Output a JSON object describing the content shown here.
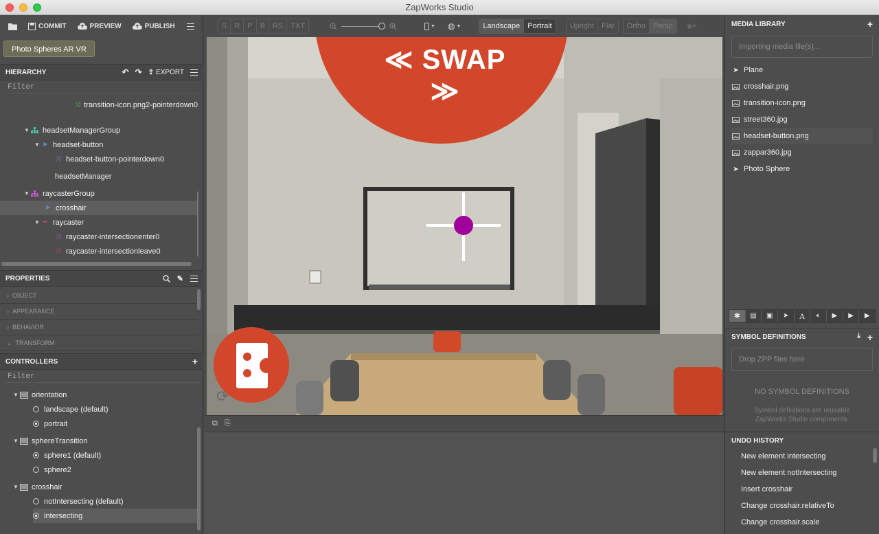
{
  "window": {
    "title": "ZapWorks Studio"
  },
  "toolbar": {
    "commit": "COMMIT",
    "preview": "PREVIEW",
    "publish": "PUBLISH",
    "project_button": "Photo Spheres AR VR"
  },
  "hierarchy": {
    "title": "HIERARCHY",
    "export_label": "EXPORT",
    "filter_placeholder": "Filter",
    "items": [
      {
        "label": "transition-icon.png2-pointerdown0",
        "icon": "transition-icon",
        "icon_color": "#4cc46a"
      },
      {
        "label": "headsetManagerGroup",
        "icon": "group-icon",
        "icon_color": "#46c8a3"
      },
      {
        "label": "headset-button",
        "icon": "plane-icon",
        "icon_color": "#6a8fd8"
      },
      {
        "label": "headset-button-pointerdown0",
        "icon": "transition-icon",
        "icon_color": "#6a8fd8"
      },
      {
        "label": "headsetManager",
        "icon": "",
        "icon_color": ""
      },
      {
        "label": "raycasterGroup",
        "icon": "group-icon",
        "icon_color": "#c85ad0"
      },
      {
        "label": "crosshair",
        "icon": "plane-icon",
        "icon_color": "#6a8fd8"
      },
      {
        "label": "raycaster",
        "icon": "raycaster-icon",
        "icon_color": "#e0406a"
      },
      {
        "label": "raycaster-intersectionenter0",
        "icon": "transition-icon",
        "icon_color": "#c85ad0"
      },
      {
        "label": "raycaster-intersectionleave0",
        "icon": "transition-icon",
        "icon_color": "#e0406a"
      }
    ]
  },
  "properties": {
    "title": "PROPERTIES",
    "sections": [
      "OBJECT",
      "APPEARANCE",
      "BEHAVIOR",
      "TRANSFORM"
    ]
  },
  "controllers": {
    "title": "CONTROLLERS",
    "filter_placeholder": "Filter",
    "groups": [
      {
        "name": "orientation",
        "states": [
          {
            "label": "landscape (default)",
            "checked": false
          },
          {
            "label": "portrait",
            "checked": true
          }
        ]
      },
      {
        "name": "sphereTransition",
        "states": [
          {
            "label": "sphere1 (default)",
            "checked": true
          },
          {
            "label": "sphere2",
            "checked": false
          }
        ]
      },
      {
        "name": "crosshair",
        "states": [
          {
            "label": "notIntersecting (default)",
            "checked": false
          },
          {
            "label": "intersecting",
            "checked": true
          }
        ]
      }
    ]
  },
  "viewport_toolbar": {
    "text_modes": [
      "S",
      "R",
      "P",
      "B",
      "RS",
      "TXT"
    ],
    "orientation_options": [
      "Landscape",
      "Portrait"
    ],
    "orientation_selected": "Landscape",
    "view_options": [
      "Upright",
      "Flat"
    ],
    "projection_options": [
      "Ortho",
      "Persp"
    ]
  },
  "viewport": {
    "swap_label": "≪ SWAP ≫",
    "accent_color": "#d2472b",
    "crosshair_dot_color": "#a1009a"
  },
  "media_library": {
    "title": "MEDIA LIBRARY",
    "status_text": "Importing media file(s)...",
    "items": [
      {
        "label": "Plane",
        "icon": "plane-icon"
      },
      {
        "label": "crosshair.png",
        "icon": "image-icon"
      },
      {
        "label": "transition-icon.png",
        "icon": "image-icon"
      },
      {
        "label": "street360.jpg",
        "icon": "image-icon"
      },
      {
        "label": "headset-button.png",
        "icon": "image-icon"
      },
      {
        "label": "zappar360.jpg",
        "icon": "image-icon"
      },
      {
        "label": "Photo Sphere",
        "icon": "plane-icon"
      }
    ]
  },
  "symbol_definitions": {
    "title": "SYMBOL DEFINITIONS",
    "drop_placeholder": "Drop ZPP files here",
    "empty_title": "NO SYMBOL DEFINITIONS",
    "empty_desc": "Symbol definitions are reusable ZapWorks Studio components."
  },
  "undo_history": {
    "title": "UNDO HISTORY",
    "items": [
      "New element intersecting",
      "New element notIntersecting",
      "Insert crosshair",
      "Change crosshair.relativeTo",
      "Change crosshair.scale"
    ]
  }
}
